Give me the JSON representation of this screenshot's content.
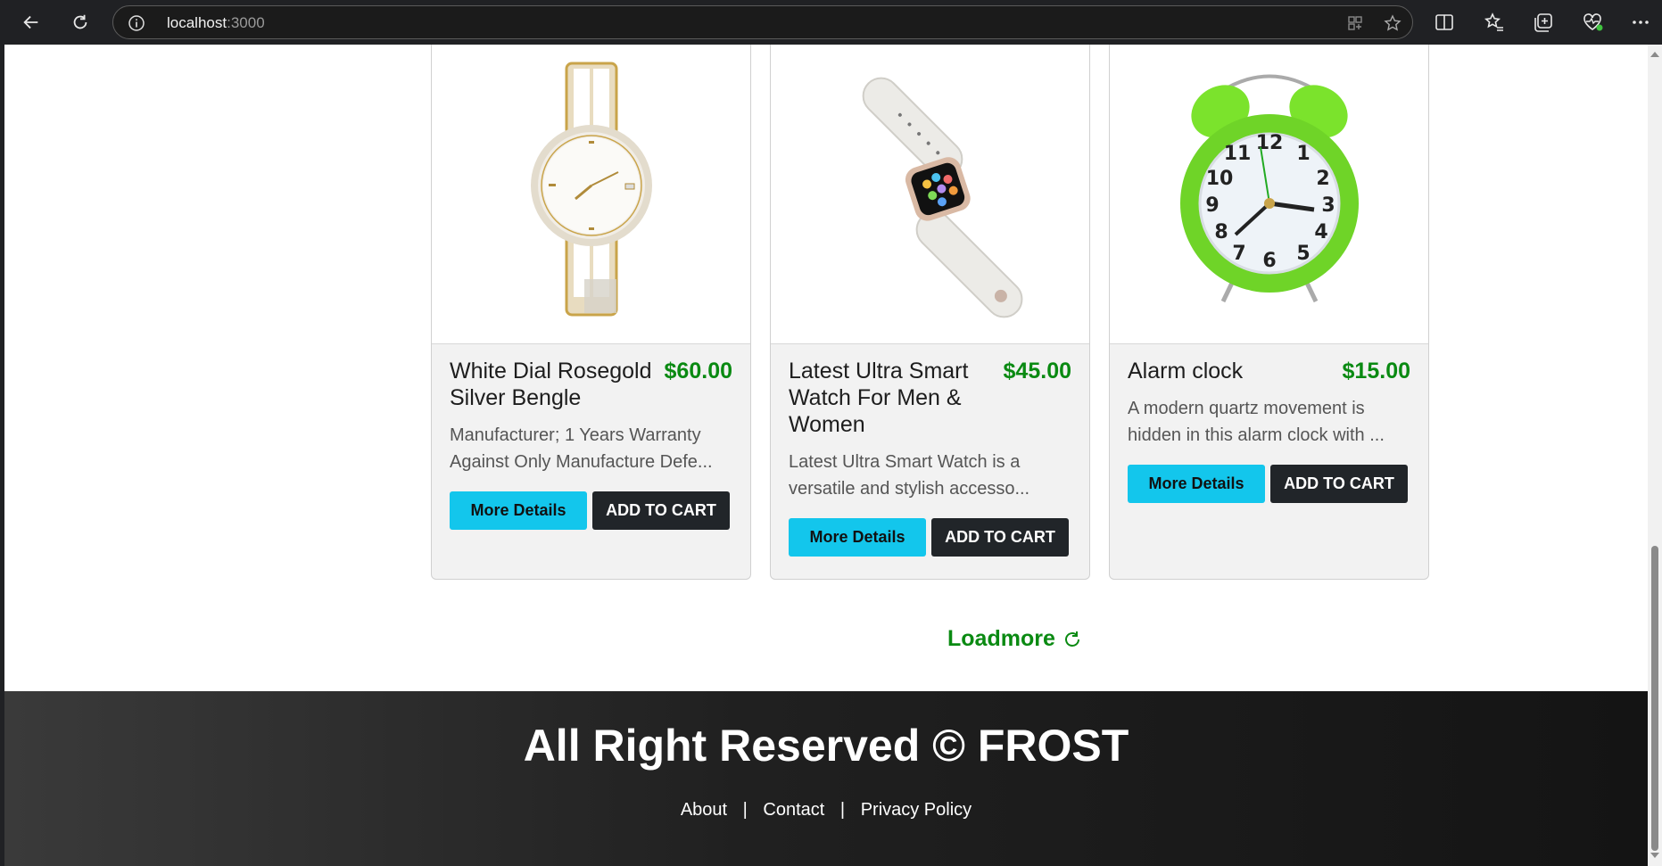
{
  "browser": {
    "url_host": "localhost",
    "url_port": ":3000"
  },
  "products": [
    {
      "name": "White Dial Rosegold Silver Bengle",
      "price": "$60.00",
      "description": "Manufacturer; 1 Years Warranty Against Only Manufacture Defe...",
      "more_label": "More Details",
      "cart_label": "ADD TO CART"
    },
    {
      "name": "Latest Ultra Smart Watch For Men & Women",
      "price": "$45.00",
      "description": "Latest Ultra Smart Watch is a versatile and stylish accesso...",
      "more_label": "More Details",
      "cart_label": "ADD TO CART"
    },
    {
      "name": "Alarm clock",
      "price": "$15.00",
      "description": "A modern quartz movement is hidden in this alarm clock with ...",
      "more_label": "More Details",
      "cart_label": "ADD TO CART"
    }
  ],
  "loadmore_label": "Loadmore",
  "footer": {
    "copyright": "All Right Reserved © FROST",
    "links": [
      "About",
      "Contact",
      "Privacy Policy"
    ],
    "separator": "|"
  },
  "colors": {
    "accent_price": "#0a8a12",
    "more_button": "#13c6ec",
    "cart_button": "#212529"
  },
  "icons": [
    "back-arrow-icon",
    "refresh-icon",
    "info-icon",
    "apps-icon",
    "star-icon",
    "split-screen-icon",
    "favorites-icon",
    "collections-icon",
    "health-icon",
    "more-icon",
    "reload-spin-icon"
  ]
}
